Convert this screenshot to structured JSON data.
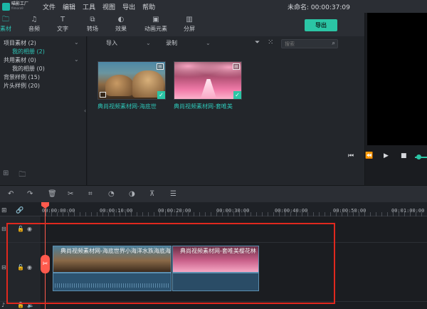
{
  "app": {
    "logo_title": "喵影工厂",
    "logo_sub": "filmora9",
    "menu": [
      "文件",
      "编辑",
      "工具",
      "视图",
      "导出",
      "帮助"
    ],
    "project_title": "未命名: 00:00:37:09"
  },
  "tabs": [
    {
      "label": "素材",
      "icon": "folder-icon"
    },
    {
      "label": "音频",
      "icon": "music-note-icon"
    },
    {
      "label": "文字",
      "icon": "text-icon"
    },
    {
      "label": "转场",
      "icon": "transition-icon"
    },
    {
      "label": "效果",
      "icon": "effects-icon"
    },
    {
      "label": "动画元素",
      "icon": "image-icon"
    },
    {
      "label": "分屏",
      "icon": "split-screen-icon"
    }
  ],
  "export_label": "导出",
  "sidebar": {
    "items": [
      {
        "label": "项目素材 (2)"
      },
      {
        "label": "我的相册 (2)"
      },
      {
        "label": "共用素材 (0)"
      },
      {
        "label": "我的相册 (0)"
      },
      {
        "label": "背景样例 (15)"
      },
      {
        "label": "片头样例 (20)"
      }
    ]
  },
  "media": {
    "import_label": "导入",
    "record_label": "录制",
    "search_placeholder": "搜索",
    "clips": [
      {
        "name": "典尚视频素材网-海底世"
      },
      {
        "name": "典尚视频素材网-套唯美"
      }
    ]
  },
  "ruler": {
    "timecodes": [
      "00:00:00:00",
      "00:00:10:00",
      "00:00:20:00",
      "00:00:30:00",
      "00:00:40:00",
      "00:00:50:00",
      "00:01:00:00"
    ]
  },
  "timeline": {
    "clips": [
      {
        "label": "典尚视频素材网-海底世界小海洋水族海底海"
      },
      {
        "label": "典尚视频素材网-套唯美樱花林"
      }
    ]
  },
  "colors": {
    "accent": "#2bc5a5",
    "playhead": "#ff5a4d",
    "highlight": "#e0281e"
  }
}
